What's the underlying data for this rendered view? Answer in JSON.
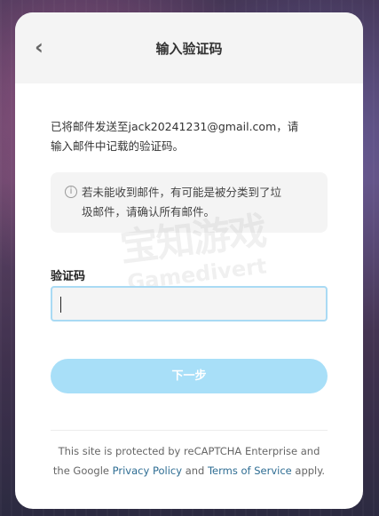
{
  "header": {
    "title": "输入验证码",
    "back_icon": "chevron-left-icon"
  },
  "message": {
    "line1": "已将邮件发送至jack20241231@gmail.com，请",
    "line2": "输入邮件中记载的验证码。"
  },
  "notice": {
    "icon": "info-circle-icon",
    "line1": "若未能收到邮件，有可能是被分类到了垃",
    "line2": "圾邮件，请确认所有邮件。"
  },
  "watermark": {
    "cn": "宝知游戏",
    "en": "Gamedivert"
  },
  "form": {
    "label": "验证码",
    "value": ""
  },
  "actions": {
    "next_label": "下一步"
  },
  "footer": {
    "text_before": "This site is protected by reCAPTCHA Enterprise and",
    "text_line2_prefix": "the Google ",
    "privacy_label": "Privacy Policy",
    "and_text": " and ",
    "terms_label": "Terms of Service",
    "suffix": " apply."
  },
  "colors": {
    "accent": "#a8dff8",
    "input_border": "#a9daf4",
    "link": "#2e6d93"
  }
}
